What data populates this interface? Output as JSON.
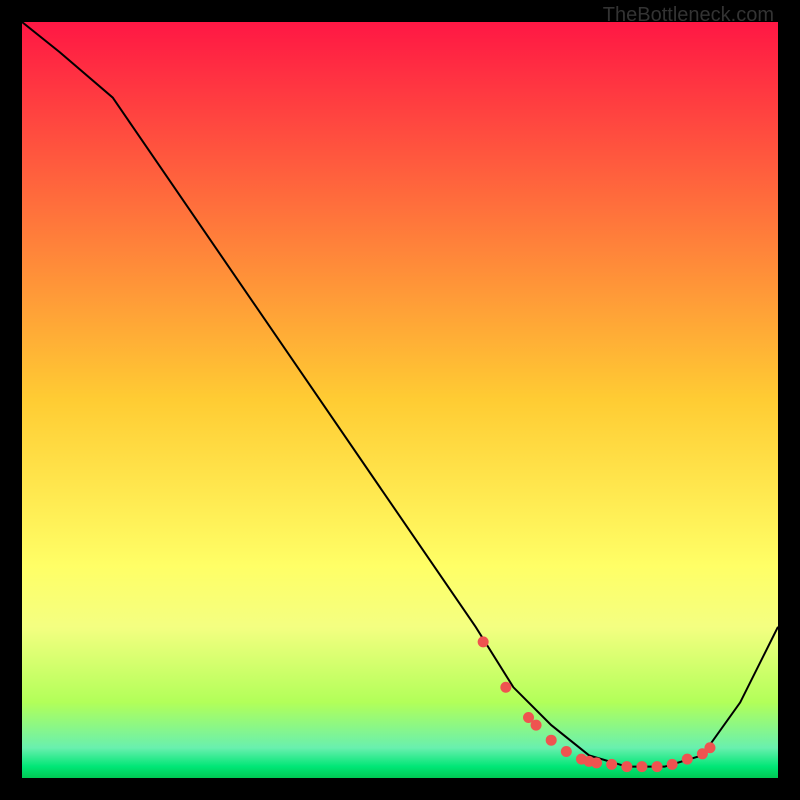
{
  "watermark": "TheBottleneck.com",
  "chart_data": {
    "type": "line",
    "title": "",
    "xlabel": "",
    "ylabel": "",
    "xlim": [
      0,
      100
    ],
    "ylim": [
      0,
      100
    ],
    "grid": false,
    "background_gradient_stops": [
      {
        "pos": 0.0,
        "color": "#ff1744"
      },
      {
        "pos": 0.5,
        "color": "#ffcc33"
      },
      {
        "pos": 0.72,
        "color": "#ffff66"
      },
      {
        "pos": 0.8,
        "color": "#f4ff81"
      },
      {
        "pos": 0.9,
        "color": "#b2ff59"
      },
      {
        "pos": 0.96,
        "color": "#69f0ae"
      },
      {
        "pos": 0.985,
        "color": "#00e676"
      },
      {
        "pos": 1.0,
        "color": "#00c853"
      }
    ],
    "series": [
      {
        "name": "curve",
        "x": [
          0,
          5,
          12,
          60,
          65,
          70,
          75,
          80,
          85,
          90,
          95,
          100
        ],
        "y": [
          100,
          96,
          90,
          20,
          12,
          7,
          3,
          1.5,
          1.5,
          3,
          10,
          20
        ]
      }
    ],
    "markers": {
      "name": "dots",
      "x": [
        61,
        64,
        67,
        68,
        70,
        72,
        74,
        75,
        76,
        78,
        80,
        82,
        84,
        86,
        88,
        90,
        91
      ],
      "y": [
        18,
        12,
        8,
        7,
        5,
        3.5,
        2.5,
        2.2,
        2,
        1.8,
        1.5,
        1.5,
        1.5,
        1.8,
        2.5,
        3.2,
        4
      ]
    }
  }
}
